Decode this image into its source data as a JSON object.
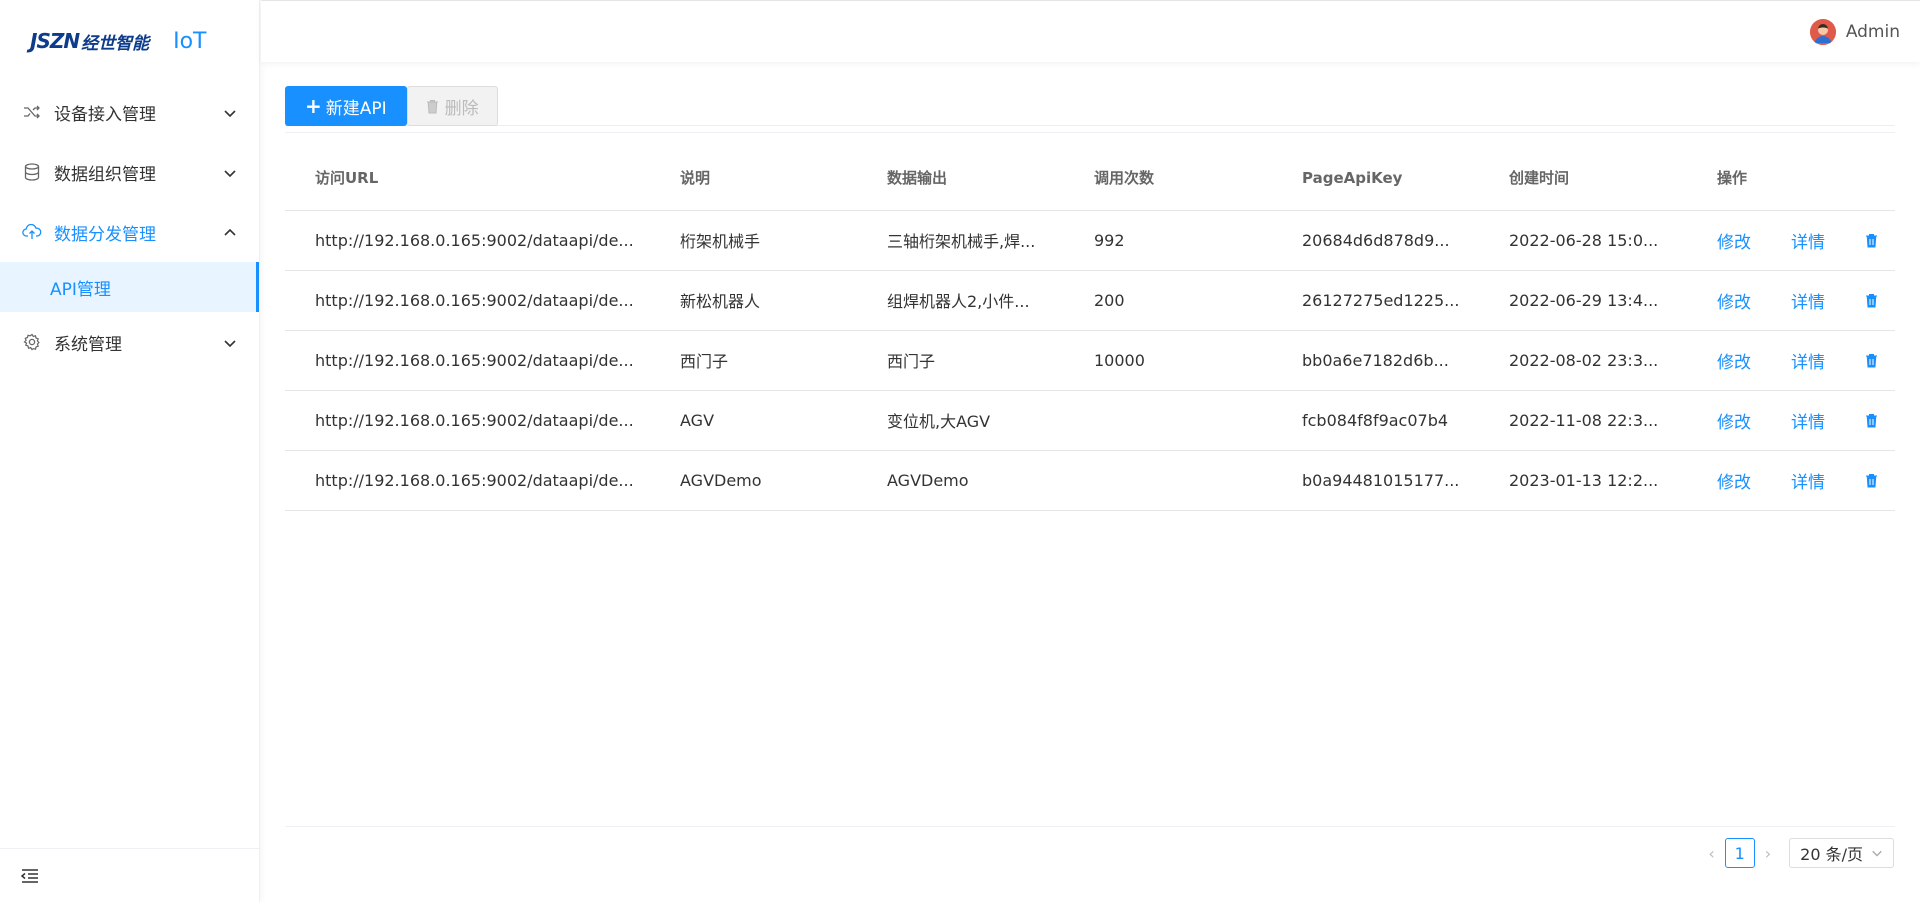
{
  "brand": {
    "logo_text": "JSZN",
    "logo_cn": "经世智能",
    "product": "IoT"
  },
  "sidebar": {
    "items": [
      {
        "label": "设备接入管理",
        "icon": "shuffle-icon",
        "expanded": false
      },
      {
        "label": "数据组织管理",
        "icon": "database-icon",
        "expanded": false
      },
      {
        "label": "数据分发管理",
        "icon": "cloud-upload-icon",
        "expanded": true,
        "active": true,
        "children": [
          {
            "label": "API管理",
            "active": true
          }
        ]
      },
      {
        "label": "系统管理",
        "icon": "gear-icon",
        "expanded": false
      }
    ],
    "collapse_icon": "menu-fold-icon"
  },
  "header": {
    "user_name": "Admin",
    "avatar_icon": "user-avatar-icon"
  },
  "toolbar": {
    "new_label": "新建API",
    "delete_label": "删除"
  },
  "table": {
    "columns": [
      "访问URL",
      "说明",
      "数据输出",
      "调用次数",
      "PageApiKey",
      "创建时间",
      "操作"
    ],
    "rows": [
      {
        "url": "http://192.168.0.165:9002/dataapi/de...",
        "desc": "桁架机械手",
        "output": "三轴桁架机械手,焊...",
        "calls": "992",
        "key": "20684d6d878d9...",
        "created": "2022-06-28 15:0..."
      },
      {
        "url": "http://192.168.0.165:9002/dataapi/de...",
        "desc": "新松机器人",
        "output": "组焊机器人2,小件...",
        "calls": "200",
        "key": "26127275ed1225...",
        "created": "2022-06-29 13:4..."
      },
      {
        "url": "http://192.168.0.165:9002/dataapi/de...",
        "desc": "西门子",
        "output": "西门子",
        "calls": "10000",
        "key": "bb0a6e7182d6b...",
        "created": "2022-08-02 23:3..."
      },
      {
        "url": "http://192.168.0.165:9002/dataapi/de...",
        "desc": "AGV",
        "output": "变位机,大AGV",
        "calls": "",
        "key": "fcb084f8f9ac07b4",
        "created": "2022-11-08 22:3..."
      },
      {
        "url": "http://192.168.0.165:9002/dataapi/de...",
        "desc": "AGVDemo",
        "output": "AGVDemo",
        "calls": "",
        "key": "b0a94481015177...",
        "created": "2023-01-13 12:2..."
      }
    ],
    "edit_label": "修改",
    "detail_label": "详情"
  },
  "pagination": {
    "current_page": "1",
    "page_size": "20 条/页"
  },
  "colors": {
    "primary": "#1890ff",
    "brand": "#0d3c8c"
  }
}
